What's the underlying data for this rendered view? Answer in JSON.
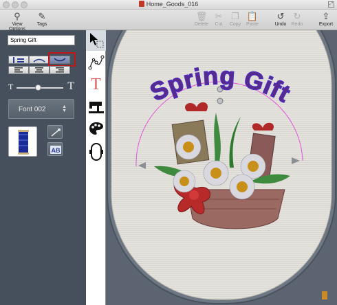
{
  "window": {
    "title": "Home_Goods_016"
  },
  "toolbar": {
    "view_options": "View Options",
    "tags": "Tags",
    "delete": "Delete",
    "cut": "Cut",
    "copy": "Copy",
    "paste": "Paste",
    "undo": "Undo",
    "redo": "Redo",
    "export": "Export"
  },
  "text_panel": {
    "text_value": "Spring Gift",
    "font_label": "Font 002",
    "size_slider_value": 0.45,
    "text_letter": "T",
    "ab_letters": "AB"
  },
  "tools": [
    "select-tool",
    "shape-tool",
    "text-tool",
    "stitch-tool",
    "color-tool",
    "hoop-tool"
  ],
  "canvas": {
    "design_text": "Spring Gift"
  },
  "colors": {
    "panel": "#45505c",
    "hoop": "#5b6470",
    "fabric": "#e4e2dc",
    "text_fill": "#5a2a88",
    "text_outline": "#4b2bb8",
    "highlight": "#c0161a",
    "arc_guide": "#e050e0"
  }
}
